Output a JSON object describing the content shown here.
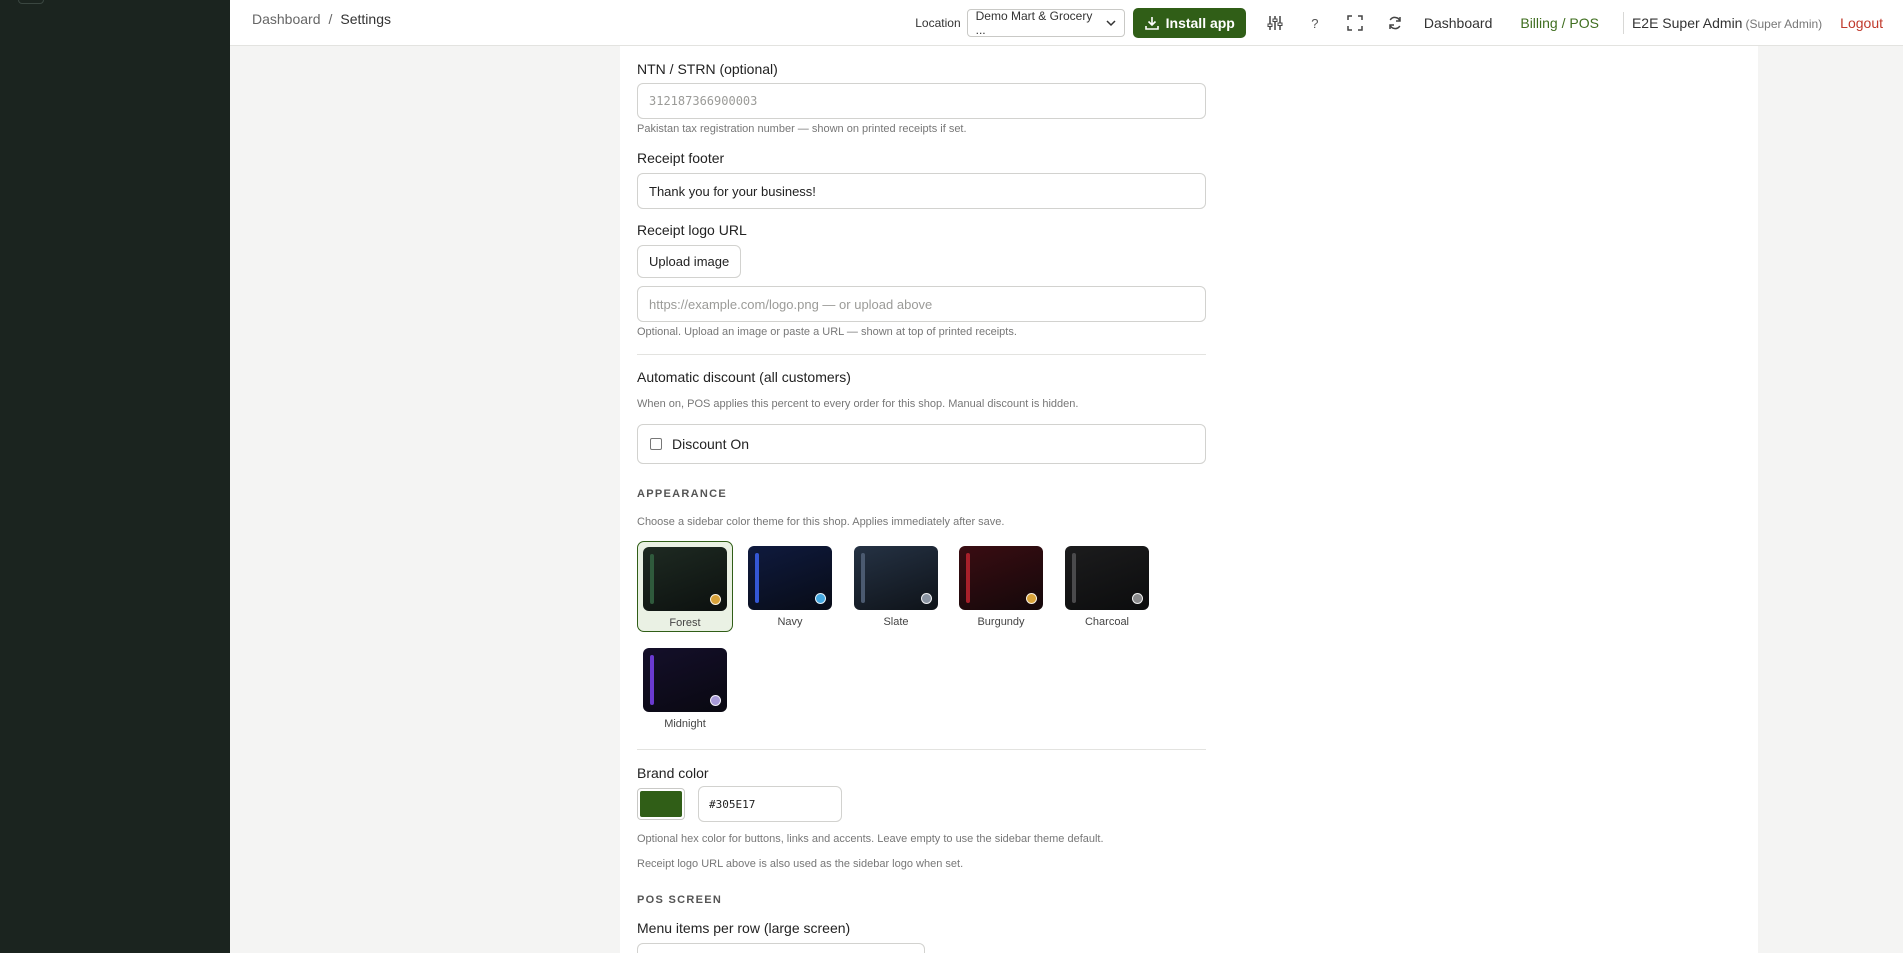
{
  "breadcrumb": {
    "parent": "Dashboard",
    "separator": "/",
    "current": "Settings"
  },
  "topbar": {
    "location_label": "Location",
    "location_value": "Demo Mart & Grocery ...",
    "install_label": "Install app",
    "help_label": "?",
    "dashboard_link": "Dashboard",
    "billing_link": "Billing / POS",
    "user_name": "E2E Super Admin",
    "user_role": "(Super Admin)",
    "logout_label": "Logout"
  },
  "form": {
    "ntn_label": "NTN / STRN (optional)",
    "ntn_placeholder": "312187366900003",
    "ntn_hint": "Pakistan tax registration number — shown on printed receipts if set.",
    "footer_label": "Receipt footer",
    "footer_value": "Thank you for your business!",
    "logo_label": "Receipt logo URL",
    "upload_label": "Upload image",
    "logo_placeholder": "https://example.com/logo.png — or upload above",
    "logo_hint": "Optional. Upload an image or paste a URL — shown at top of printed receipts.",
    "discount_title": "Automatic discount (all customers)",
    "discount_hint": "When on, POS applies this percent to every order for this shop. Manual discount is hidden.",
    "discount_checkbox_label": "Discount On"
  },
  "appearance": {
    "section_title": "APPEARANCE",
    "hint": "Choose a sidebar color theme for this shop. Applies immediately after save.",
    "selected": "Forest",
    "themes": [
      {
        "name": "Forest",
        "bg": "#1e2a22",
        "bar": "#2f5a3c",
        "dot": "#d8a23a"
      },
      {
        "name": "Navy",
        "bg": "#0f1a3e",
        "bar": "#3457d5",
        "dot": "#45a8e0"
      },
      {
        "name": "Slate",
        "bg": "#253244",
        "bar": "#4b5a70",
        "dot": "#8a94a2"
      },
      {
        "name": "Burgundy",
        "bg": "#3a0d12",
        "bar": "#a8202a",
        "dot": "#d8a23a"
      },
      {
        "name": "Charcoal",
        "bg": "#1c1c1d",
        "bar": "#4a4a4c",
        "dot": "#8a8a8c"
      },
      {
        "name": "Midnight",
        "bg": "#140f2a",
        "bar": "#6a3ad0",
        "dot": "#a89ad8"
      }
    ]
  },
  "brand": {
    "label": "Brand color",
    "color": "#305E17",
    "hex_value": "#305E17",
    "hint1": "Optional hex color for buttons, links and accents. Leave empty to use the sidebar theme default.",
    "hint2": "Receipt logo URL above is also used as the sidebar logo when set."
  },
  "pos_screen": {
    "section_title": "POS SCREEN",
    "menu_items_label": "Menu items per row (large screen)"
  }
}
